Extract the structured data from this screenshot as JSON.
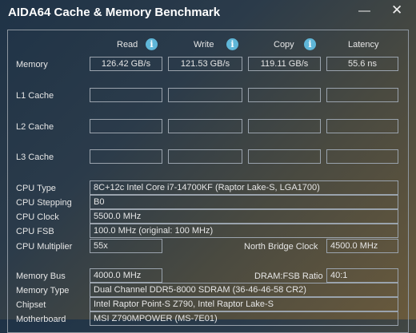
{
  "window": {
    "title": "AIDA64 Cache & Memory Benchmark",
    "minimize_glyph": "—",
    "close_glyph": "✕"
  },
  "columns": {
    "read": "Read",
    "write": "Write",
    "copy": "Copy",
    "latency": "Latency"
  },
  "info_glyph": "i",
  "rows": {
    "memory": {
      "label": "Memory",
      "read": "126.42 GB/s",
      "write": "121.53 GB/s",
      "copy": "119.11 GB/s",
      "latency": "55.6 ns"
    },
    "l1": {
      "label": "L1 Cache",
      "read": "",
      "write": "",
      "copy": "",
      "latency": ""
    },
    "l2": {
      "label": "L2 Cache",
      "read": "",
      "write": "",
      "copy": "",
      "latency": ""
    },
    "l3": {
      "label": "L3 Cache",
      "read": "",
      "write": "",
      "copy": "",
      "latency": ""
    }
  },
  "cpu": {
    "type_label": "CPU Type",
    "type_value": "8C+12c Intel Core i7-14700KF  (Raptor Lake-S, LGA1700)",
    "stepping_label": "CPU Stepping",
    "stepping_value": "B0",
    "clock_label": "CPU Clock",
    "clock_value": "5500.0 MHz",
    "fsb_label": "CPU FSB",
    "fsb_value": "100.0 MHz  (original: 100 MHz)",
    "multiplier_label": "CPU Multiplier",
    "multiplier_value": "55x",
    "nb_clock_label": "North Bridge Clock",
    "nb_clock_value": "4500.0 MHz"
  },
  "memory_info": {
    "bus_label": "Memory Bus",
    "bus_value": "4000.0 MHz",
    "ratio_label": "DRAM:FSB Ratio",
    "ratio_value": "40:1",
    "type_label": "Memory Type",
    "type_value": "Dual Channel DDR5-8000 SDRAM  (36-46-46-58 CR2)",
    "chipset_label": "Chipset",
    "chipset_value": "Intel Raptor Point-S Z790, Intel Raptor Lake-S",
    "motherboard_label": "Motherboard",
    "motherboard_value": "MSI Z790MPOWER (MS-7E01)"
  }
}
